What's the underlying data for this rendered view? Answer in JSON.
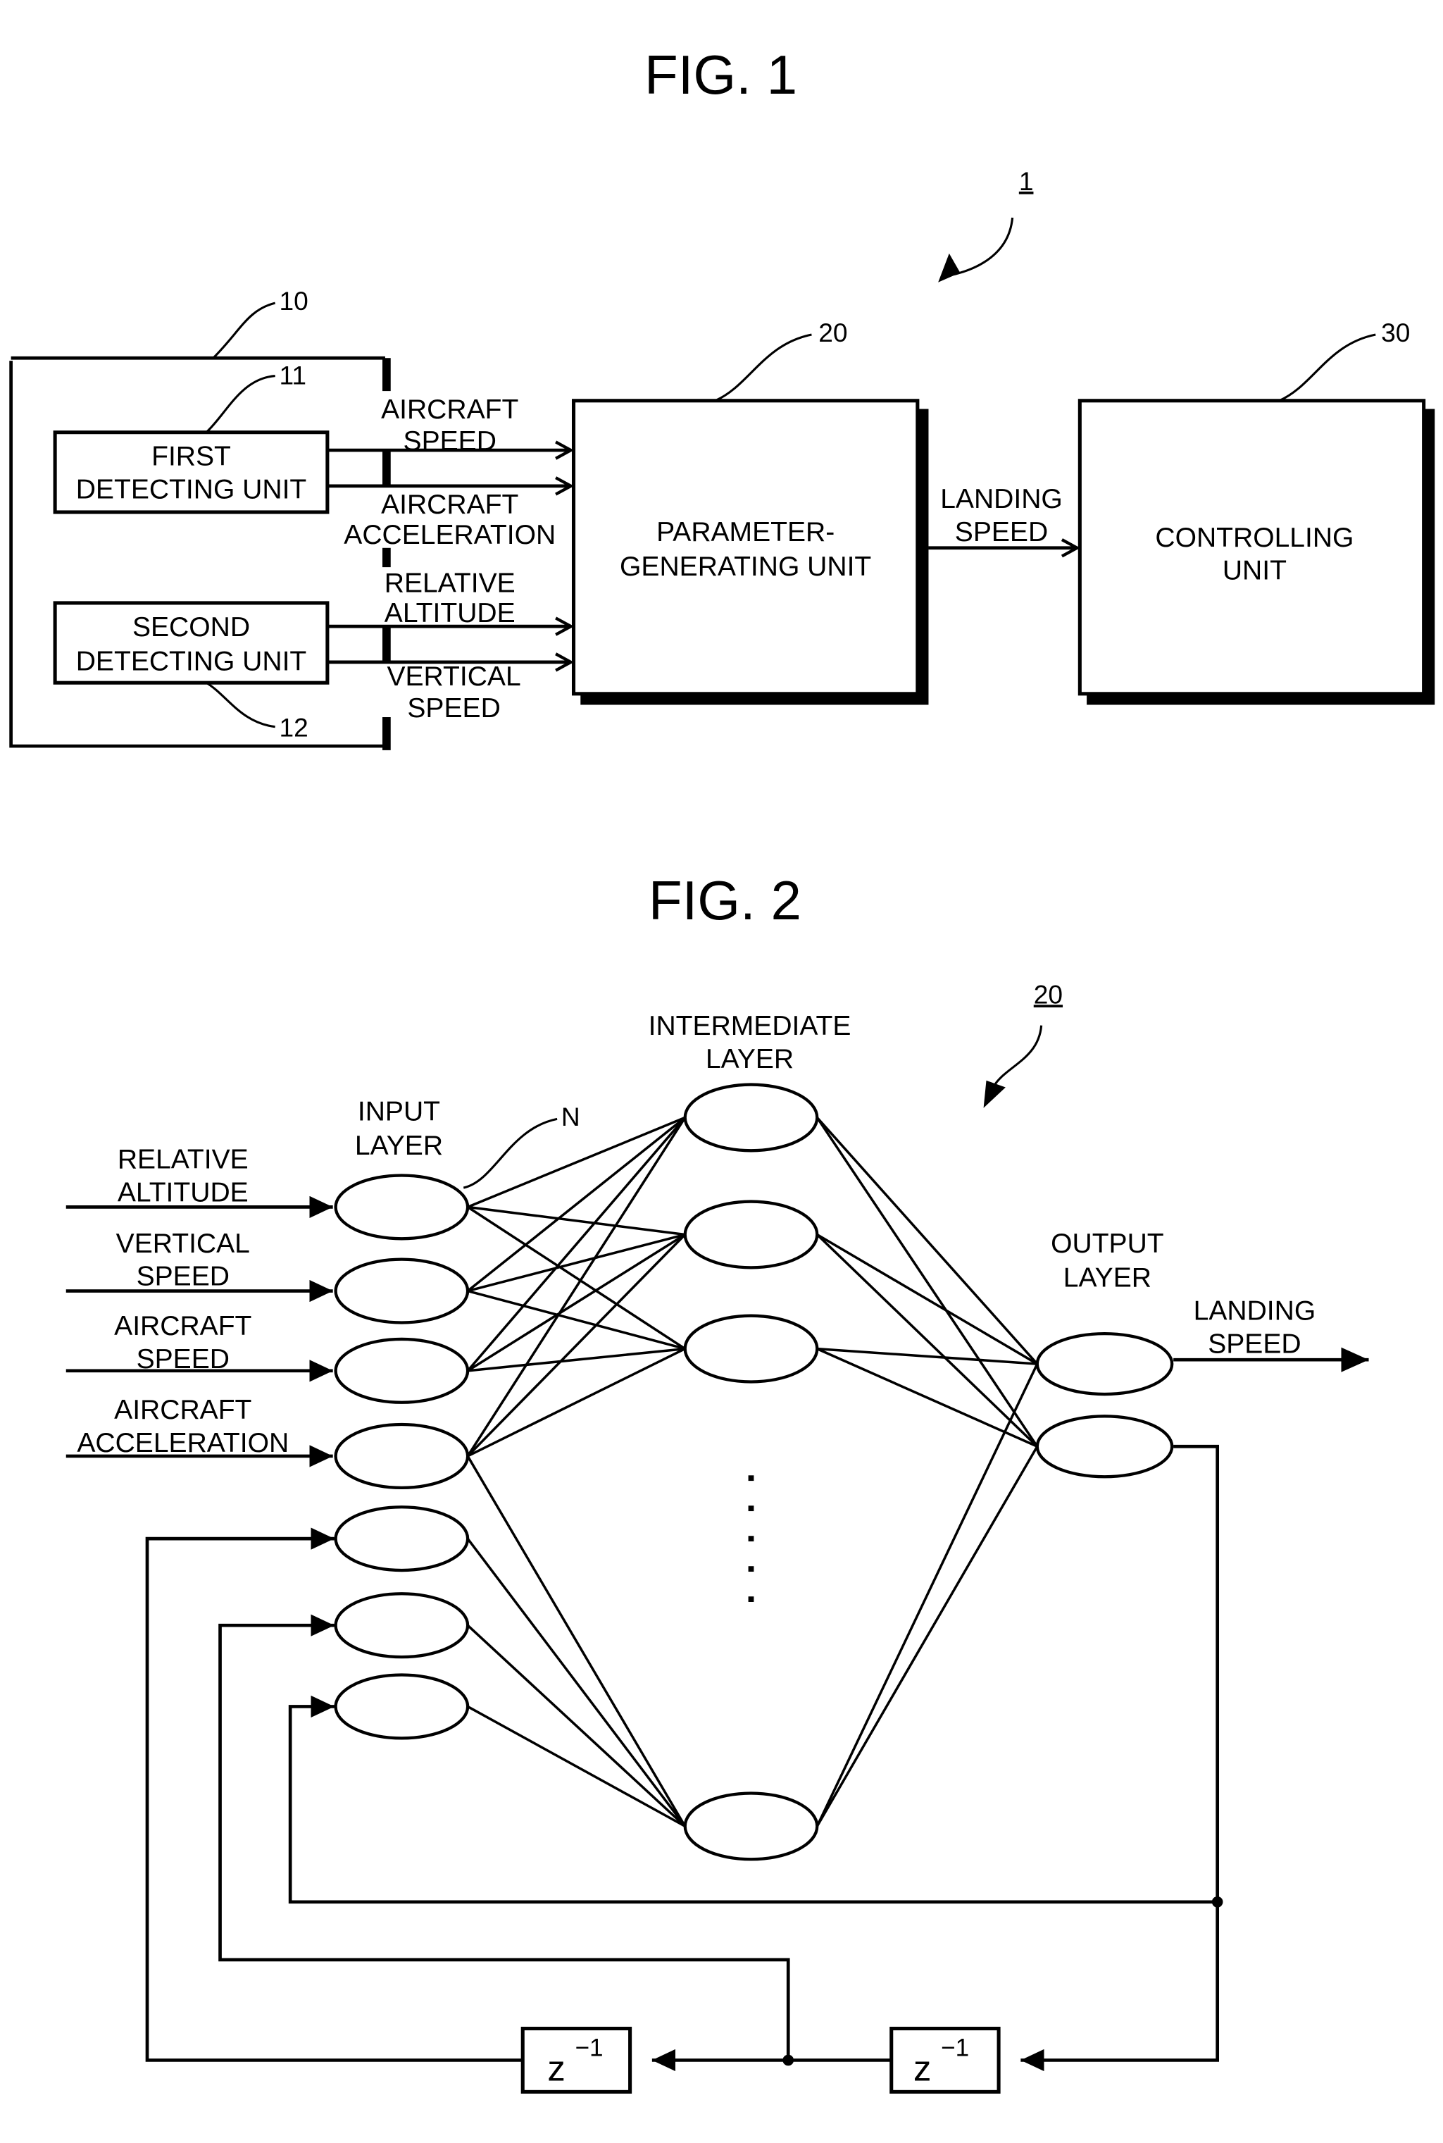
{
  "fig1": {
    "title": "FIG. 1",
    "system_ref": "1",
    "detecting_section": {
      "ref": "10",
      "first_unit": {
        "ref": "11",
        "lines": [
          "FIRST",
          "DETECTING UNIT"
        ]
      },
      "second_unit": {
        "ref": "12",
        "lines": [
          "SECOND",
          "DETECTING UNIT"
        ]
      }
    },
    "signals": {
      "aircraft_speed": [
        "AIRCRAFT",
        "SPEED"
      ],
      "aircraft_acceleration": [
        "AIRCRAFT",
        "ACCELERATION"
      ],
      "relative_altitude": [
        "RELATIVE",
        "ALTITUDE"
      ],
      "vertical_speed": [
        "VERTICAL",
        "SPEED"
      ],
      "landing_speed": [
        "LANDING",
        "SPEED"
      ]
    },
    "parameter_unit": {
      "ref": "20",
      "lines": [
        "PARAMETER-",
        "GENERATING UNIT"
      ]
    },
    "controlling_unit": {
      "ref": "30",
      "lines": [
        "CONTROLLING",
        "UNIT"
      ]
    }
  },
  "fig2": {
    "title": "FIG. 2",
    "network_ref": "20",
    "node_marker": "N",
    "layers": {
      "input": [
        "INPUT",
        "LAYER"
      ],
      "intermediate": [
        "INTERMEDIATE",
        "LAYER"
      ],
      "output": [
        "OUTPUT",
        "LAYER"
      ]
    },
    "inputs": [
      [
        "RELATIVE",
        "ALTITUDE"
      ],
      [
        "VERTICAL",
        "SPEED"
      ],
      [
        "AIRCRAFT",
        "SPEED"
      ],
      [
        "AIRCRAFT",
        "ACCELERATION"
      ]
    ],
    "output_label": [
      "LANDING",
      "SPEED"
    ],
    "delay": {
      "base": "z",
      "exponent": "−1"
    },
    "counts": {
      "input_nodes": 7,
      "intermediate_nodes_shown": 4,
      "output_nodes": 2,
      "delay_units": 2
    }
  }
}
